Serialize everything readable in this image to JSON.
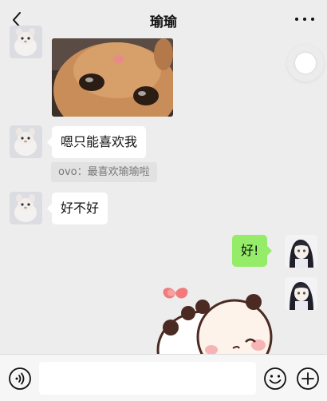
{
  "header": {
    "title": "瑜瑜"
  },
  "messages": [
    {
      "side": "left",
      "type": "image",
      "sender": "other"
    },
    {
      "side": "left",
      "type": "text",
      "text": "嗯只能喜欢我",
      "quote": "ovo：最喜欢瑜瑜啦"
    },
    {
      "side": "left",
      "type": "text",
      "text": "好不好"
    },
    {
      "side": "right",
      "type": "text",
      "text": "好!"
    },
    {
      "side": "right",
      "type": "sticker"
    }
  ],
  "input": {
    "value": "",
    "placeholder": ""
  },
  "icons": {
    "back": "chevron-left-icon",
    "more": "ellipsis-icon",
    "voice": "voice-icon",
    "emoji": "smiley-icon",
    "plus": "plus-icon"
  },
  "colors": {
    "background": "#ededed",
    "self_bubble": "#95ec69",
    "other_bubble": "#ffffff"
  }
}
